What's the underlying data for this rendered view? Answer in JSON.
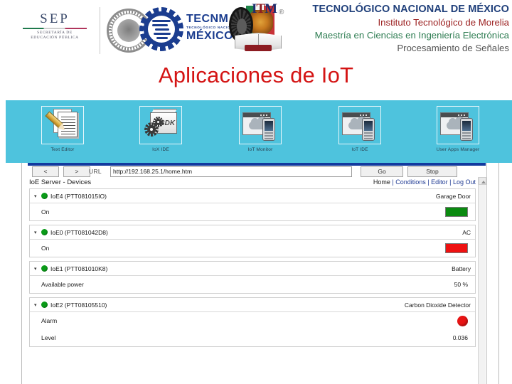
{
  "header": {
    "institution_line1": "TECNOLÓGICO NACIONAL DE MÉXICO",
    "institution_line2": "Instituto Tecnológico de Morelia",
    "institution_line3": "Maestría en Ciencias en Ingeniería Electrónica",
    "institution_line4": "Procesamiento de Señales",
    "sep_logo": {
      "word": "SEP",
      "sub_line1": "SECRETARÍA DE",
      "sub_line2": "EDUCACIÓN PÚBLICA"
    },
    "tecnm_logo": {
      "line1": "TECNM",
      "line2": "TECNOLÓGICO NACIONAL DE",
      "line3": "MÉXICO"
    },
    "itm_logo": {
      "letters_i": "I",
      "letters_t": "T",
      "letters_m": "M"
    },
    "registered_mark": "®",
    "colors": {
      "line1": "#1f3f7a",
      "line2": "#9b1f1f",
      "line3": "#2e7d52",
      "line4": "#555555"
    }
  },
  "slide_title": "Aplicaciones de IoT",
  "app_bar": {
    "background": "#4ec3dd",
    "apps": [
      {
        "label": "Text Editor",
        "icon": "text-editor-icon"
      },
      {
        "label": "IoX IDE",
        "icon": "iox-ide-sdk-box-icon"
      },
      {
        "label": "IoT Monitor",
        "icon": "cloud-window-phone-icon"
      },
      {
        "label": "IoT IDE",
        "icon": "cloud-window-phone-icon"
      },
      {
        "label": "User Apps Manager",
        "icon": "cloud-window-phone-icon"
      }
    ]
  },
  "browser": {
    "back_label": "<",
    "forward_label": ">",
    "url_label": "URL",
    "url_value": "http://192.168.25.1/home.htm",
    "go_label": "Go",
    "stop_label": "Stop",
    "page_title": "IoE Server - Devices",
    "nav_links": [
      "Home",
      "Conditions",
      "Editor",
      "Log Out"
    ],
    "nav_separator": " | "
  },
  "devices": [
    {
      "id": "IoE4 (PTT081015IO)",
      "type": "Garage Door",
      "status_dot": "#0a9b18",
      "rows": [
        {
          "label": "On",
          "value": "",
          "indicator": "swatch",
          "color": "#0a8a10"
        }
      ]
    },
    {
      "id": "IoE0 (PTT081042D8)",
      "type": "AC",
      "status_dot": "#0a9b18",
      "rows": [
        {
          "label": "On",
          "value": "",
          "indicator": "swatch",
          "color": "#ee1111"
        }
      ]
    },
    {
      "id": "IoE1 (PTT081010K8)",
      "type": "Battery",
      "status_dot": "#0a9b18",
      "rows": [
        {
          "label": "Available power",
          "value": "50 %",
          "indicator": "text",
          "color": ""
        }
      ]
    },
    {
      "id": "IoE2 (PTT08105510)",
      "type": "Carbon Dioxide Detector",
      "status_dot": "#0a9b18",
      "rows": [
        {
          "label": "Alarm",
          "value": "",
          "indicator": "circle",
          "color": "#e81414"
        },
        {
          "label": "Level",
          "value": "0.036",
          "indicator": "text",
          "color": ""
        }
      ]
    }
  ]
}
